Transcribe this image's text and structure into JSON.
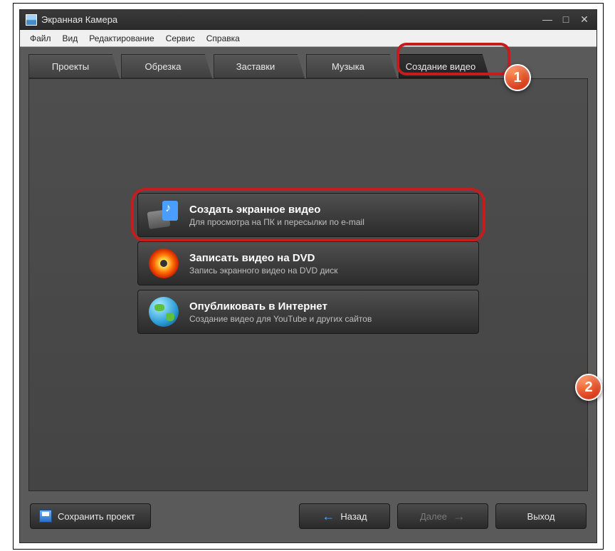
{
  "window": {
    "title": "Экранная Камера"
  },
  "menubar": [
    "Файл",
    "Вид",
    "Редактирование",
    "Сервис",
    "Справка"
  ],
  "tabs": [
    {
      "label": "Проекты"
    },
    {
      "label": "Обрезка"
    },
    {
      "label": "Заставки"
    },
    {
      "label": "Музыка"
    },
    {
      "label": "Создание видео"
    }
  ],
  "options": [
    {
      "title": "Создать экранное видео",
      "sub": "Для просмотра на ПК и пересылки по e-mail"
    },
    {
      "title": "Записать видео на DVD",
      "sub": "Запись экранного видео на DVD диск"
    },
    {
      "title": "Опубликовать в Интернет",
      "sub": "Создание видео для YouTube и других сайтов"
    }
  ],
  "footer": {
    "save": "Сохранить проект",
    "back": "Назад",
    "next": "Далее",
    "exit": "Выход"
  },
  "markers": {
    "one": "1",
    "two": "2"
  }
}
